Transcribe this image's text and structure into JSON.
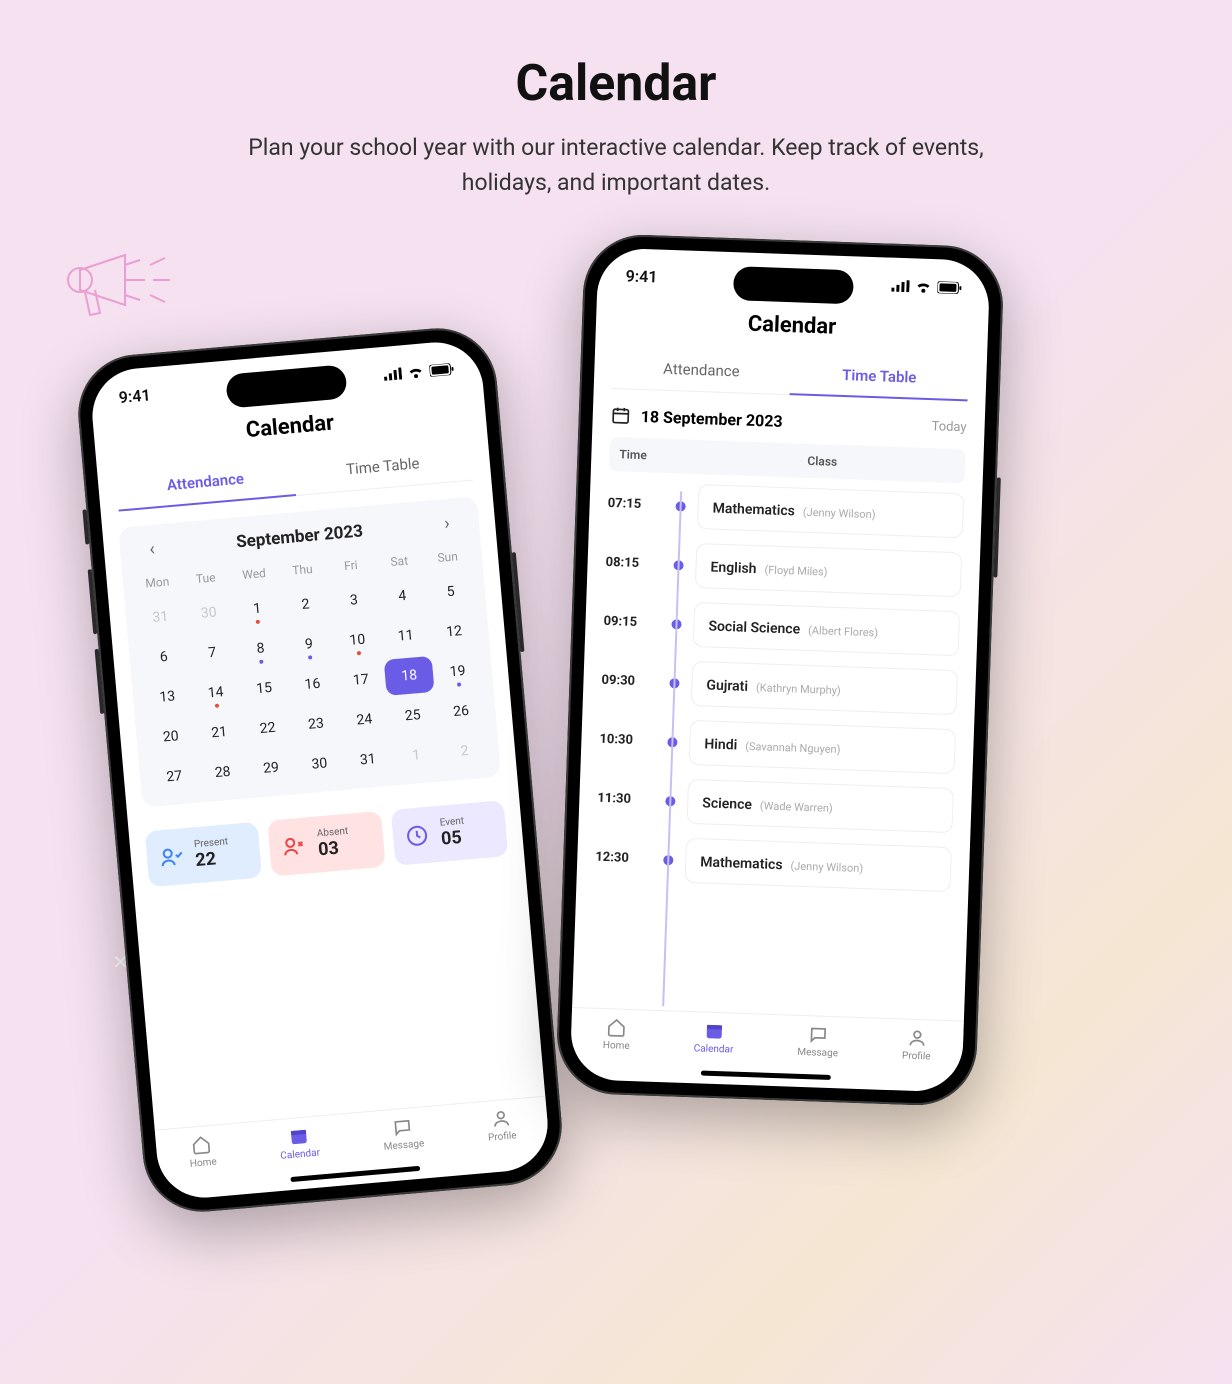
{
  "hero": {
    "title": "Calendar",
    "subtitle": "Plan your school year with our interactive calendar. Keep track of events, holidays, and important dates."
  },
  "status": {
    "time": "9:41"
  },
  "screen_title": "Calendar",
  "tabs": {
    "attendance": "Attendance",
    "timetable": "Time Table"
  },
  "calendar": {
    "month": "September 2023",
    "dow": [
      "Mon",
      "Tue",
      "Wed",
      "Thu",
      "Fri",
      "Sat",
      "Sun"
    ],
    "weeks": [
      [
        {
          "n": "31",
          "muted": true
        },
        {
          "n": "30",
          "muted": true
        },
        {
          "n": "1",
          "dot": "r"
        },
        {
          "n": "2"
        },
        {
          "n": "3"
        },
        {
          "n": "4"
        },
        {
          "n": "5"
        }
      ],
      [
        {
          "n": "6"
        },
        {
          "n": "7"
        },
        {
          "n": "8",
          "dot": "b"
        },
        {
          "n": "9",
          "dot": "b"
        },
        {
          "n": "10",
          "dot": "r"
        },
        {
          "n": "11"
        },
        {
          "n": "12"
        }
      ],
      [
        {
          "n": "13"
        },
        {
          "n": "14",
          "dot": "r"
        },
        {
          "n": "15"
        },
        {
          "n": "16"
        },
        {
          "n": "17"
        },
        {
          "n": "18",
          "sel": true
        },
        {
          "n": "19",
          "dot": "b"
        }
      ],
      [
        {
          "n": "20"
        },
        {
          "n": "21"
        },
        {
          "n": "22"
        },
        {
          "n": "23"
        },
        {
          "n": "24"
        },
        {
          "n": "25"
        },
        {
          "n": "26"
        }
      ],
      [
        {
          "n": "27"
        },
        {
          "n": "28"
        },
        {
          "n": "29"
        },
        {
          "n": "30"
        },
        {
          "n": "31"
        },
        {
          "n": "1",
          "muted": true
        },
        {
          "n": "2",
          "muted": true
        }
      ]
    ]
  },
  "stats": {
    "present": {
      "label": "Present",
      "value": "22"
    },
    "absent": {
      "label": "Absent",
      "value": "03"
    },
    "event": {
      "label": "Event",
      "value": "05"
    }
  },
  "timetable": {
    "date": "18 September 2023",
    "today": "Today",
    "col_time": "Time",
    "col_class": "Class",
    "rows": [
      {
        "time": "07:15",
        "subject": "Mathematics",
        "teacher": "(Jenny Wilson)"
      },
      {
        "time": "08:15",
        "subject": "English",
        "teacher": "(Floyd Miles)"
      },
      {
        "time": "09:15",
        "subject": "Social Science",
        "teacher": "(Albert Flores)"
      },
      {
        "time": "09:30",
        "subject": "Gujrati",
        "teacher": "(Kathryn Murphy)"
      },
      {
        "time": "10:30",
        "subject": "Hindi",
        "teacher": "(Savannah Nguyen)"
      },
      {
        "time": "11:30",
        "subject": "Science",
        "teacher": "(Wade Warren)"
      },
      {
        "time": "12:30",
        "subject": "Mathematics",
        "teacher": "(Jenny Wilson)"
      }
    ]
  },
  "nav": {
    "home": "Home",
    "calendar": "Calendar",
    "message": "Message",
    "profile": "Profile"
  }
}
